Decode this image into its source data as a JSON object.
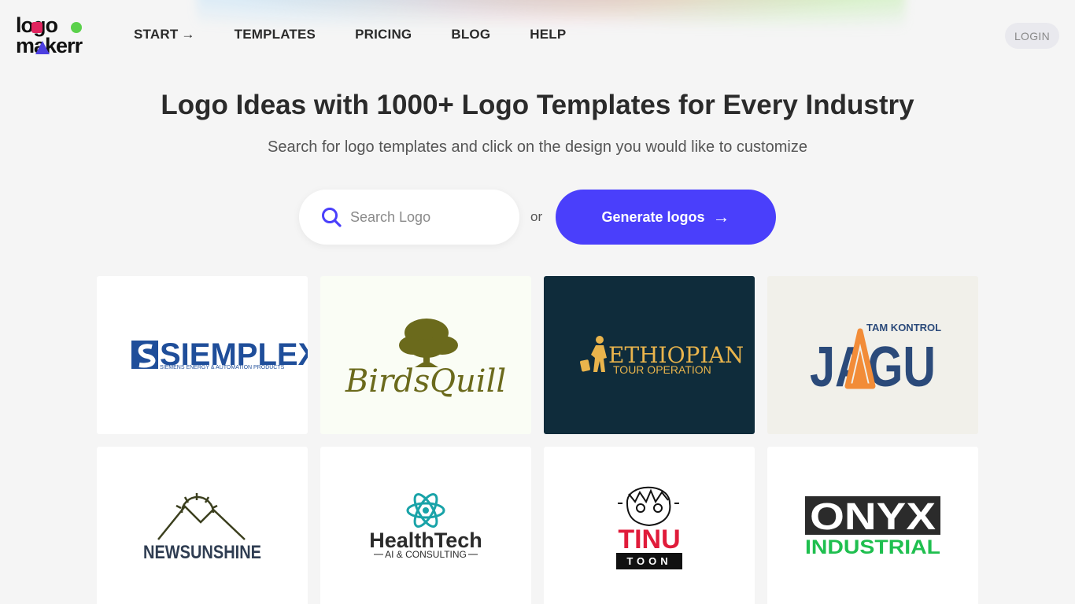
{
  "header": {
    "logo_top": "logo",
    "logo_bottom": "makerr",
    "nav": [
      {
        "label": "START",
        "has_arrow": true
      },
      {
        "label": "TEMPLATES"
      },
      {
        "label": "PRICING"
      },
      {
        "label": "BLOG"
      },
      {
        "label": "HELP"
      }
    ],
    "login_label": "LOGIN"
  },
  "hero": {
    "title": "Logo Ideas with 1000+ Logo Templates for Every Industry",
    "subtitle": "Search for logo templates and click on the design you would like to customize",
    "search_placeholder": "Search Logo",
    "or_label": "or",
    "generate_label": "Generate logos"
  },
  "templates": [
    {
      "name": "SIEMPLEX",
      "tagline": "SIEMENS ENERGY & AUTOMATION PRODUCTS",
      "bg": "#ffffff",
      "color": "#1f4e9a"
    },
    {
      "name": "BirdsQuill",
      "bg": "#fafdf5",
      "color": "#6b6a1c"
    },
    {
      "name": "ETHIOPIAN",
      "tagline": "TOUR OPERATION",
      "bg": "#0f2c3b",
      "color": "#e9b44c"
    },
    {
      "name": "JAGU",
      "tagline": "TAM KONTROL",
      "bg": "#f1f0ea",
      "color": "#2b4a7a",
      "accent": "#f28c38"
    },
    {
      "name": "NEWSUNSHINE",
      "bg": "#ffffff",
      "color": "#2f3d52"
    },
    {
      "name": "HealthTech",
      "tagline": "AI & CONSULTING",
      "bg": "#ffffff",
      "color": "#2b2b2b",
      "accent": "#19a3a8"
    },
    {
      "name": "TINU",
      "tagline": "TOON",
      "bg": "#ffffff",
      "color": "#e01b3a"
    },
    {
      "name": "ONYX",
      "tagline": "INDUSTRIAL",
      "bg": "#ffffff",
      "color": "#2b2b2b",
      "accent": "#1fbf4f"
    }
  ],
  "colors": {
    "accent": "#4a3ffb",
    "search_icon": "#4a3ffb"
  }
}
